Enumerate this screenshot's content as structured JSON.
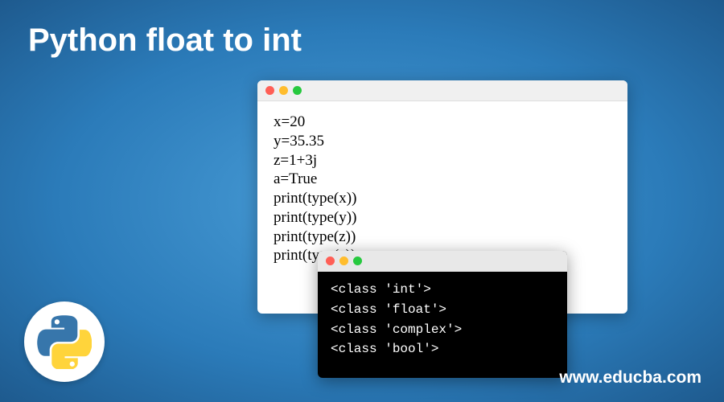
{
  "title": "Python float to int",
  "url": "www.educba.com",
  "code_window": {
    "lines": [
      "x=20",
      "y=35.35",
      "z=1+3j",
      "a=True",
      "print(type(x))",
      "print(type(y))",
      "print(type(z))",
      "print(type(a))"
    ]
  },
  "output_window": {
    "lines": [
      "<class 'int'>",
      "<class 'float'>",
      "<class 'complex'>",
      "<class 'bool'>"
    ]
  },
  "logo": {
    "name": "python-logo"
  }
}
